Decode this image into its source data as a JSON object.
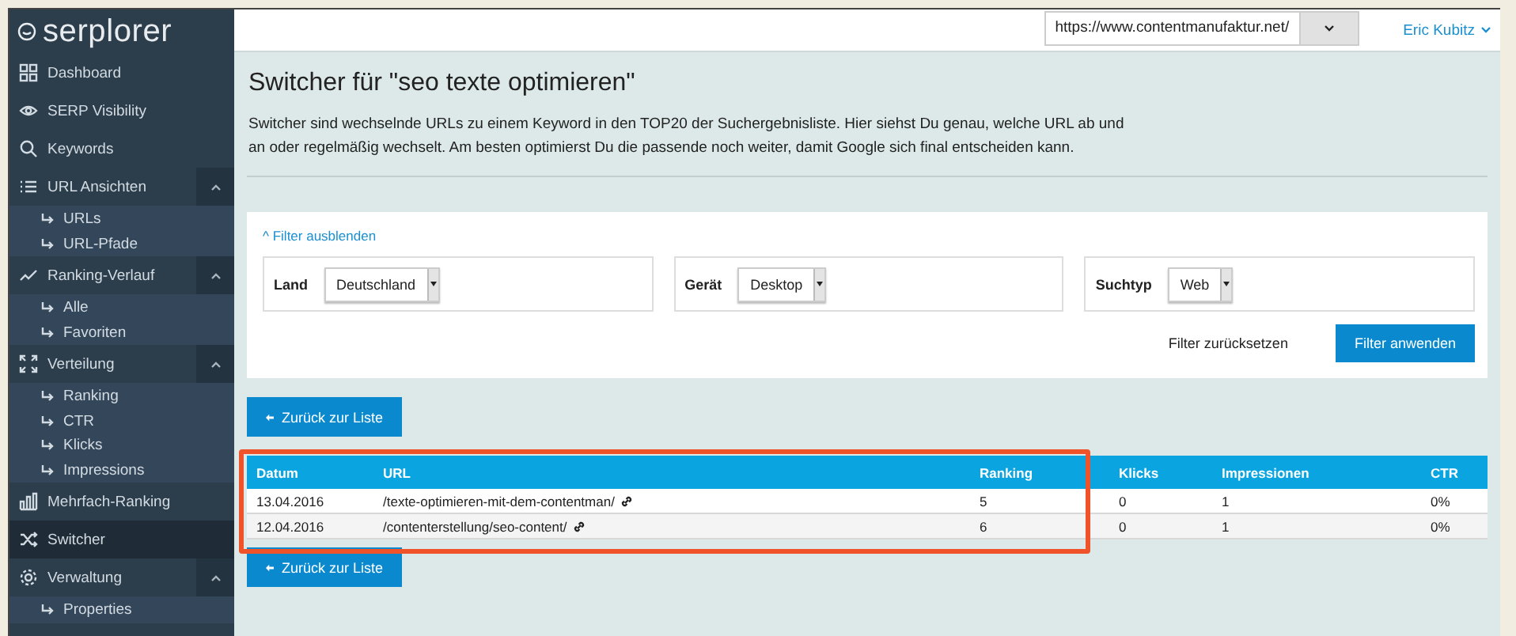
{
  "sidebar": {
    "logo": "serplorer",
    "items": [
      {
        "label": "Dashboard",
        "selected": false
      },
      {
        "label": "SERP Visibility",
        "selected": false
      },
      {
        "label": "Keywords",
        "selected": false
      },
      {
        "label": "URL Ansichten",
        "selected": false,
        "expanded": true,
        "children": [
          {
            "label": "URLs",
            "selected": false
          },
          {
            "label": "URL-Pfade",
            "selected": false
          }
        ]
      },
      {
        "label": "Ranking-Verlauf",
        "selected": false,
        "expanded": true,
        "children": [
          {
            "label": "Alle",
            "selected": false
          },
          {
            "label": "Favoriten",
            "selected": false
          }
        ]
      },
      {
        "label": "Verteilung",
        "selected": false,
        "expanded": true,
        "children": [
          {
            "label": "Ranking",
            "selected": false
          },
          {
            "label": "CTR",
            "selected": false
          },
          {
            "label": "Klicks",
            "selected": false
          },
          {
            "label": "Impressions",
            "selected": false
          }
        ]
      },
      {
        "label": "Mehrfach-Ranking",
        "selected": false
      },
      {
        "label": "Switcher",
        "selected": true
      },
      {
        "label": "Verwaltung",
        "selected": false,
        "expanded": true,
        "children": [
          {
            "label": "Properties",
            "selected": false
          }
        ]
      }
    ]
  },
  "header": {
    "site_select": "https://www.contentmanufaktur.net/",
    "user": "Eric Kubitz"
  },
  "page": {
    "title": "Switcher für \"seo texte optimieren\"",
    "description": "Switcher sind wechselnde URLs zu einem Keyword in den TOP20 der Suchergebnisliste. Hier siehst Du genau, welche URL ab und an oder regelmäßig wechselt. Am besten optimierst Du die passende noch weiter, damit Google sich final entscheiden kann."
  },
  "filter": {
    "toggle": "^ Filter ausblenden",
    "fields": [
      {
        "label": "Land",
        "value": "Deutschland"
      },
      {
        "label": "Gerät",
        "value": "Desktop"
      },
      {
        "label": "Suchtyp",
        "value": "Web"
      }
    ],
    "reset": "Filter zurücksetzen",
    "apply": "Filter anwenden"
  },
  "back_button_top": "Zurück zur Liste",
  "table": {
    "columns": [
      "Datum",
      "URL",
      "Ranking",
      "Klicks",
      "Impressionen",
      "CTR"
    ],
    "rows": [
      [
        "13.04.2016",
        "/texte-optimieren-mit-dem-contentman/",
        "5",
        "0",
        "1",
        "0%"
      ],
      [
        "12.04.2016",
        "/contenterstellung/seo-content/",
        "6",
        "0",
        "1",
        "0%"
      ]
    ]
  },
  "back_button_bottom": "Zurück zur Liste"
}
